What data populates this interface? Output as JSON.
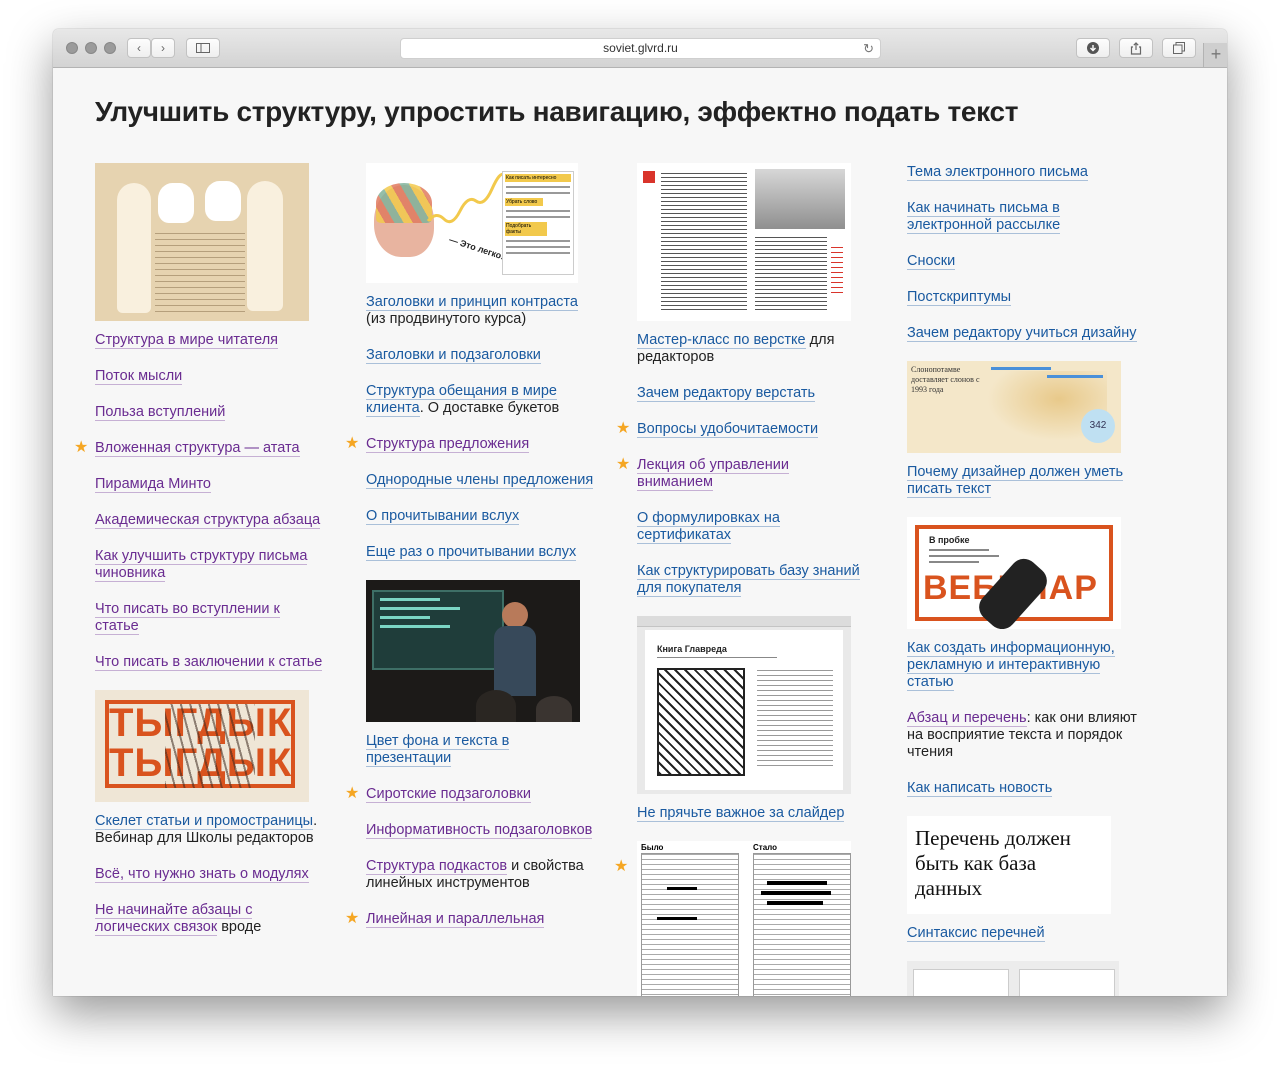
{
  "browser": {
    "url": "soviet.glvrd.ru",
    "back_icon": "‹",
    "forward_icon": "›"
  },
  "page": {
    "title": "Улучшить структуру, упростить навигацию, эффектно подать текст"
  },
  "columns": {
    "c1": {
      "items": [
        {
          "link": "Структура в мире читателя"
        },
        {
          "link": "Поток мысли"
        },
        {
          "link": "Польза вступлений"
        },
        {
          "link": "Вложенная структура — атата"
        },
        {
          "link": "Пирамида Минто"
        },
        {
          "link": "Академическая структура абзаца"
        },
        {
          "link": "Как улучшить структуру письма чиновника"
        },
        {
          "link": "Что писать во вступлении к статье"
        },
        {
          "link": "Что писать в заключении к статье"
        },
        {
          "link": "Скелет статьи и промостраницы",
          "rest": ". Вебинар для Школы редакторов"
        },
        {
          "link": "Всё, что нужно знать о модулях"
        },
        {
          "link": "Не начинайте абзацы с логических связок",
          "rest": " вроде"
        }
      ],
      "thumb2": {
        "line1": "ТЫГДЫК",
        "line2": "ТЫГДЫК"
      }
    },
    "c2": {
      "thumb1": {
        "caption": "— Это легко!",
        "tags": [
          "Как писать интересно",
          "Убрать слово",
          "Подобрать факты"
        ]
      },
      "items": [
        {
          "link": "Заголовки и принцип контраста",
          "rest": " (из продвинутого курса)"
        },
        {
          "link": "Заголовки и подзаголовки"
        },
        {
          "link": "Структура обещания в мире клиента",
          "rest": ". О доставке букетов"
        },
        {
          "link": "Структура предложения"
        },
        {
          "link": "Однородные члены предложения"
        },
        {
          "link": "О прочитывании вслух"
        },
        {
          "link": "Еще раз о прочитывании вслух"
        },
        {
          "link": "Цвет фона и текста в презентации"
        },
        {
          "link": "Сиротские подзаголовки"
        },
        {
          "link": "Информативность подзаголовков"
        },
        {
          "link": "Структура подкастов",
          "rest": " и свойства линейных инструментов"
        },
        {
          "link": "Линейная и параллельная",
          "rest": ""
        }
      ]
    },
    "c3": {
      "items": [
        {
          "link": "Мастер-класс по верстке",
          "rest": " для редакторов"
        },
        {
          "link": "Зачем редактору верстать"
        },
        {
          "link": "Вопросы удобочитаемости"
        },
        {
          "link": "Лекция об управлении вниманием"
        },
        {
          "link": "О формулировках на сертификатах"
        },
        {
          "link": "Как структурировать базу знаний для покупателя"
        },
        {
          "link": "Не прячьте важное за слайдер"
        }
      ],
      "thumb_book": {
        "title": "Книга Главреда"
      },
      "thumb_compare": {
        "before": "Было",
        "after": "Стало"
      }
    },
    "c4": {
      "items": [
        {
          "link": "Тема электронного письма"
        },
        {
          "link": "Как начинать письма в электронной рассылке"
        },
        {
          "link": "Сноски"
        },
        {
          "link": "Постскриптумы"
        },
        {
          "link": "Зачем редактору учиться дизайну"
        },
        {
          "link": "Почему дизайнер должен уметь писать текст"
        },
        {
          "link": "Как создать информационную, рекламную и интерактивную статью"
        },
        {
          "link": "Абзац и перечень",
          "rest": ": как они влияют на восприятие текста и порядок чтения"
        },
        {
          "link": "Как написать новость"
        },
        {
          "link": "Синтаксис перечней"
        }
      ],
      "thumb_map": {
        "text": "Слонопотамве доставляет слонов с 1993 года",
        "badge": "342"
      },
      "thumb_webinar": {
        "label": "В пробке",
        "word": "ВЕБИНАР"
      },
      "thumb_quote": {
        "text": "Перечень должен быть как база данных"
      }
    }
  },
  "colors": {
    "link": "#1a5aa0",
    "visited": "#6a2c91",
    "star": "#f5a623",
    "accent": "#d9531e"
  }
}
